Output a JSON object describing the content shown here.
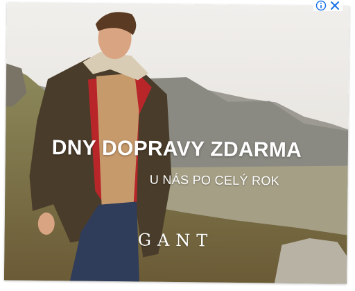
{
  "ad": {
    "headline": "DNY DOPRAVY ZDARMA",
    "subline": "U NÁS PO CELÝ ROK",
    "brand": "GANT"
  },
  "controls": {
    "info_icon": "info-icon",
    "close_icon": "close-icon",
    "accent": "#1a73e8"
  }
}
